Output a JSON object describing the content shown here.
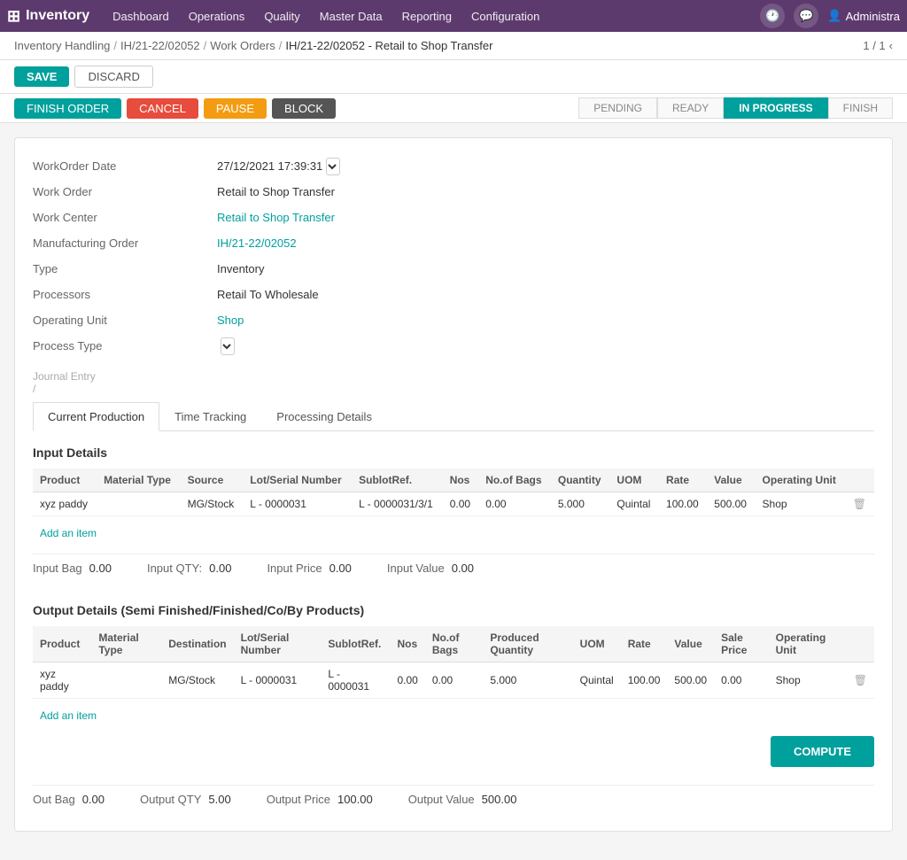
{
  "app": {
    "name": "Inventory",
    "tab_title": "# Inventory"
  },
  "topnav": {
    "logo": "Inventory",
    "menu": [
      "Dashboard",
      "Operations",
      "Quality",
      "Master Data",
      "Reporting",
      "Configuration"
    ],
    "user": "Administra"
  },
  "breadcrumb": {
    "items": [
      "Inventory Handling",
      "IH/21-22/02052",
      "Work Orders",
      "IH/21-22/02052 - Retail to Shop Transfer"
    ]
  },
  "pagination": "1 / 1",
  "actions": {
    "save": "SAVE",
    "discard": "DISCARD",
    "finish_order": "FINISH ORDER",
    "cancel": "CANCEL",
    "pause": "PAUSE",
    "block": "BLOCK"
  },
  "status_steps": [
    "PENDING",
    "READY",
    "IN PROGRESS",
    "FINISH"
  ],
  "active_step": "IN PROGRESS",
  "form": {
    "work_order_date_label": "WorkOrder Date",
    "work_order_date_value": "27/12/2021 17:39:31",
    "work_order_label": "Work Order",
    "work_order_value": "Retail to Shop Transfer",
    "work_center_label": "Work Center",
    "work_center_value": "Retail to Shop Transfer",
    "manufacturing_order_label": "Manufacturing Order",
    "manufacturing_order_value": "IH/21-22/02052",
    "type_label": "Type",
    "type_value": "Inventory",
    "processors_label": "Processors",
    "processors_value": "Retail To Wholesale",
    "operating_unit_label": "Operating Unit",
    "operating_unit_value": "Shop",
    "process_type_label": "Process Type",
    "process_type_value": "",
    "journal_entry_label": "Journal Entry",
    "journal_entry_value": "/",
    "journal_slash": "/"
  },
  "tabs": [
    "Current Production",
    "Time Tracking",
    "Processing Details"
  ],
  "active_tab": "Current Production",
  "input_details": {
    "title": "Input Details",
    "columns": [
      "Product",
      "Material Type",
      "Source",
      "Lot/Serial Number",
      "SublotRef.",
      "Nos",
      "No.of Bags",
      "Quantity",
      "UOM",
      "Rate",
      "Value",
      "Operating Unit"
    ],
    "rows": [
      {
        "product": "xyz paddy",
        "material_type": "",
        "source": "MG/Stock",
        "lot_serial": "L - 0000031",
        "sublot_ref": "L - 0000031/3/1",
        "nos": "0.00",
        "no_of_bags": "0.00",
        "quantity": "5.000",
        "uom": "Quintal",
        "rate": "100.00",
        "value": "500.00",
        "operating_unit": "Shop"
      }
    ],
    "add_item": "Add an item",
    "summary": {
      "input_bag_label": "Input Bag",
      "input_bag_value": "0.00",
      "input_qty_label": "Input QTY:",
      "input_qty_value": "0.00",
      "input_price_label": "Input Price",
      "input_price_value": "0.00",
      "input_value_label": "Input Value",
      "input_value_value": "0.00"
    }
  },
  "output_details": {
    "title": "Output Details (Semi Finished/Finished/Co/By Products)",
    "columns": [
      "Product",
      "Material Type",
      "Destination",
      "Lot/Serial Number",
      "SublotRef.",
      "Nos",
      "No.of Bags",
      "Produced Quantity",
      "UOM",
      "Rate",
      "Value",
      "Sale Price",
      "Operating Unit"
    ],
    "rows": [
      {
        "product": "xyz paddy",
        "material_type": "",
        "destination": "MG/Stock",
        "lot_serial": "L - 0000031",
        "sublot_ref": "L - 0000031",
        "nos": "0.00",
        "no_of_bags": "0.00",
        "produced_qty": "5.000",
        "uom": "Quintal",
        "rate": "100.00",
        "value": "500.00",
        "sale_price": "0.00",
        "operating_unit": "Shop"
      }
    ],
    "add_item": "Add an item",
    "compute": "COMPUTE",
    "summary": {
      "out_bag_label": "Out Bag",
      "out_bag_value": "0.00",
      "output_qty_label": "Output QTY",
      "output_qty_value": "5.00",
      "output_price_label": "Output Price",
      "output_price_value": "100.00",
      "output_value_label": "Output Value",
      "output_value_value": "500.00"
    }
  }
}
